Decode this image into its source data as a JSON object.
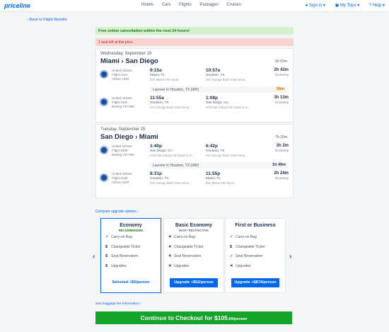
{
  "header": {
    "logo": "priceline",
    "nav": [
      "Hotels",
      "Cars",
      "Flights",
      "Packages",
      "Cruises"
    ],
    "sign_in": "Sign in",
    "my_trips": "My Trips",
    "help": "Help"
  },
  "back_link": "‹ Back to Flight Results",
  "notices": {
    "cancellation": "Free online cancellation within the next 24 hours!",
    "seats": "1 seat left at this price"
  },
  "outbound": {
    "date": "Wednesday, September 19",
    "route": "Miami › San Diego",
    "duration": "6h 53m",
    "segments": [
      {
        "airline": "United Airlines",
        "flight": "Flight 2144",
        "aircraft": "Airbus A320",
        "dep_time": "9:15a",
        "dep_city": "Miami, FL",
        "dep_airport": "MIA Miami Intl Airport",
        "arr_time": "10:57a",
        "arr_city": "Houston, TX",
        "arr_airport": "IAH George Bush Interconne...",
        "dur": "2h 42m",
        "cabin": "Economy"
      },
      {
        "airline": "United Airlines",
        "flight": "Flight 2116",
        "aircraft": "Boeing 737-800",
        "dep_time": "11:55a",
        "dep_city": "Houston, TX",
        "dep_airport": "IAH George Bush Interconne...",
        "arr_time": "1:08p",
        "arr_city": "San Diego, CA",
        "arr_airport": "SAN San Diego Intl Airport (Lin...",
        "dur": "3h 13m",
        "cabin": "Economy"
      }
    ],
    "layover": {
      "text": "Layover in Houston, TX (IAH)",
      "dur": "58m"
    }
  },
  "return": {
    "date": "Tuesday, September 25",
    "route": "San Diego › Miami",
    "duration": "7h 15m",
    "segments": [
      {
        "airline": "United Airlines",
        "flight": "Flight 2099",
        "aircraft": "Boeing 737-800",
        "dep_time": "1:40p",
        "dep_city": "San Diego, CA",
        "dep_airport": "SAN San Diego Intl Airport (Lin...",
        "arr_time": "6:42p",
        "arr_city": "Houston, TX",
        "arr_airport": "IAH George Bush Interconne...",
        "dur": "3h 2m",
        "cabin": "Economy"
      },
      {
        "airline": "United Airlines",
        "flight": "Flight 2148",
        "aircraft": "Airbus A320",
        "dep_time": "8:31p",
        "dep_city": "Houston, TX",
        "dep_airport": "IAH George Bush Interconne...",
        "arr_time": "11:55p",
        "arr_city": "Miami, FL",
        "arr_airport": "MIA Miami Intl Airport",
        "dur": "2h 24m",
        "cabin": "Economy"
      }
    ],
    "layover": {
      "text": "Layover in Houston, TX (IAH)",
      "dur": "1h 49m"
    }
  },
  "compare_link": "Compare upgrade options",
  "fares": [
    {
      "title": "Economy",
      "subtitle": "RECOMMENDED",
      "items": [
        "Carry-on Bag",
        "Changeable Ticket",
        "Seat Reservation",
        "Upgrades"
      ],
      "button": "Selected +$0/person"
    },
    {
      "title": "Basic Economy",
      "subtitle": "MOST RESTRICTIVE",
      "items": [
        "Carry-on Bag",
        "Changeable Ticket",
        "Seat Reservation",
        "Upgrades"
      ],
      "button": "Upgrade +$52/person"
    },
    {
      "title": "First or Business",
      "subtitle": "",
      "items": [
        "Carry-on Bag",
        "Changeable Ticket",
        "Seat Reservation",
        "Upgrades"
      ],
      "button": "Upgrade +$874/person"
    }
  ],
  "baggage_link": "See baggage fee information ›",
  "cta": {
    "label": "Continue to Checkout for $105",
    "cents": ".60/person"
  }
}
